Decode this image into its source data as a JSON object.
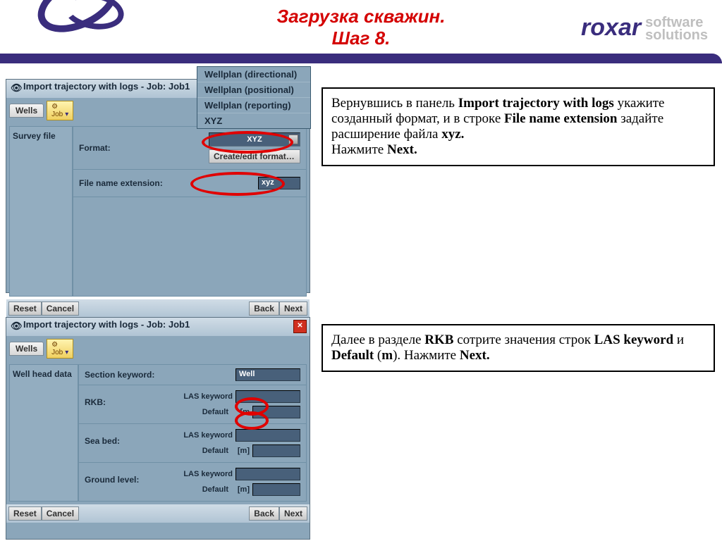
{
  "header": {
    "title1": "Загрузка скважин.",
    "title2": "Шаг 8."
  },
  "logo": {
    "brand": "roxar",
    "sub1": "software",
    "sub2": "solutions"
  },
  "popup": {
    "items": [
      "Wellplan (directional)",
      "Wellplan (positional)",
      "Wellplan (reporting)",
      "XYZ"
    ]
  },
  "win1": {
    "title": "Import trajectory with logs - Job: Job1",
    "tab": "Wells",
    "job": "Job",
    "side": "Survey file",
    "format_lbl": "Format:",
    "format_val": "XYZ",
    "edit_btn": "Create/edit format…",
    "ext_lbl": "File name extension:",
    "ext_val": "xyz",
    "reset": "Reset",
    "cancel": "Cancel",
    "back": "Back",
    "next": "Next"
  },
  "win2": {
    "title": "Import trajectory with logs - Job: Job1",
    "tab": "Wells",
    "job": "Job",
    "side": "Well head data",
    "section_lbl": "Section keyword:",
    "section_val": "Well",
    "groups": [
      {
        "name": "RKB:",
        "las": "LAS keyword",
        "def": "Default",
        "unit": "[m"
      },
      {
        "name": "Sea bed:",
        "las": "LAS keyword",
        "def": "Default",
        "unit": "[m]"
      },
      {
        "name": "Ground level:",
        "las": "LAS keyword",
        "def": "Default",
        "unit": "[m]"
      }
    ],
    "reset": "Reset",
    "cancel": "Cancel",
    "back": "Back",
    "next": "Next"
  },
  "annot1": {
    "t1": "Вернувшись в панель ",
    "b1": "Import trajectory with logs",
    "t2": " укажите созданный формат, и в строке ",
    "b2": "File name extension",
    "t3": " задайте расширение файла ",
    "b3": "xyz.",
    "t4": "Нажмите ",
    "b4": "Next."
  },
  "annot2": {
    "t1": "Далее в разделе ",
    "b1": "RKB",
    "t2": " сотрите значения строк ",
    "b2": "LAS keyword",
    "t3": " и ",
    "b3": "Default",
    "t4": " (",
    "b4": "m",
    "t5": ").",
    "t6": " Нажмите ",
    "b5": "Next."
  }
}
